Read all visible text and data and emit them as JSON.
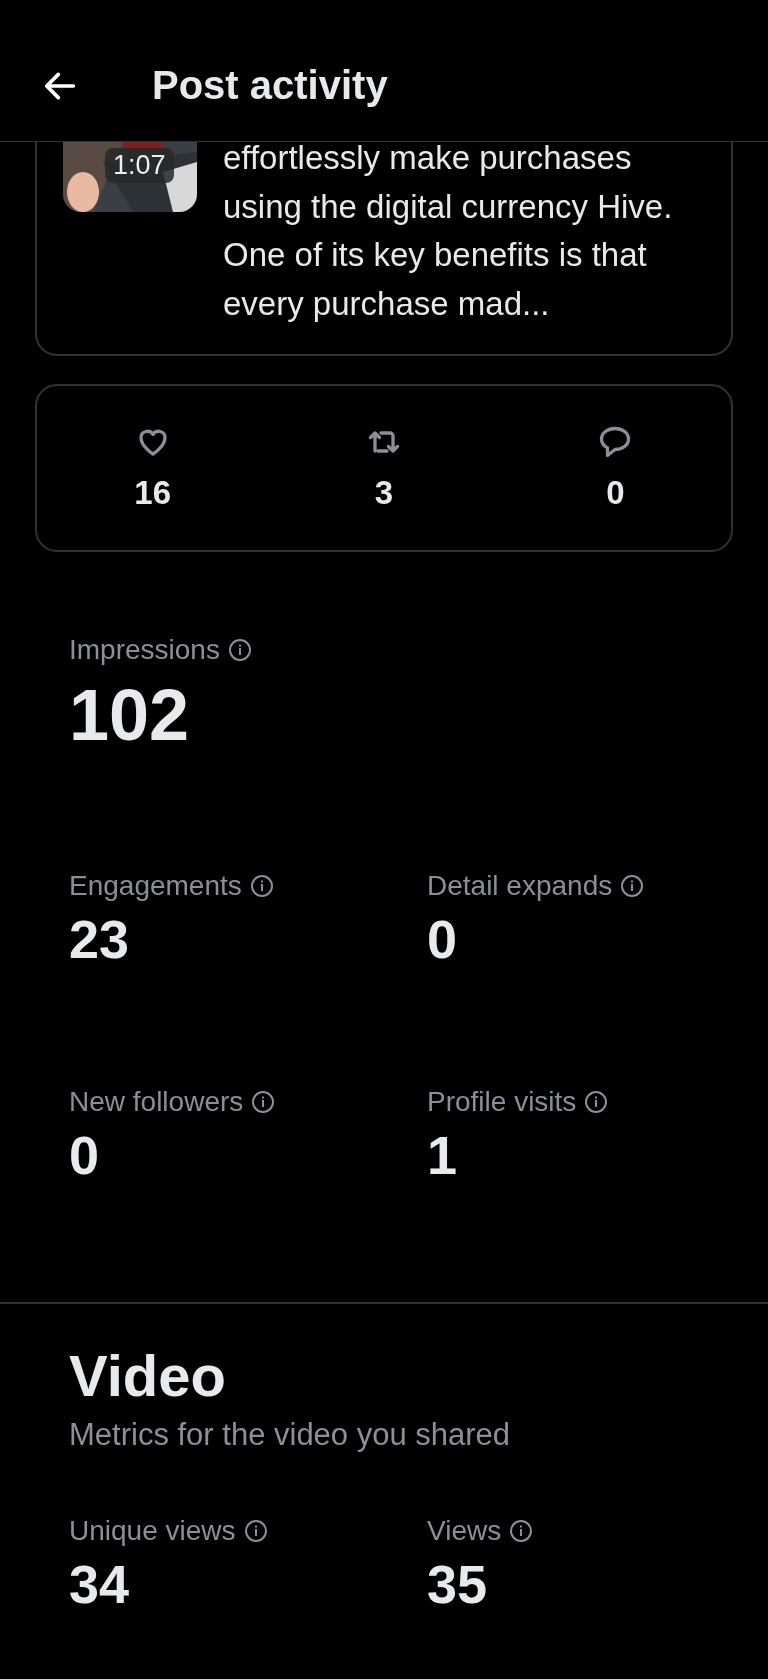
{
  "header": {
    "title": "Post activity"
  },
  "post": {
    "duration": "1:07",
    "excerpt": "effortlessly make purchases using the digital currency Hive. One of its key benefits is that every purchase mad..."
  },
  "actions": [
    {
      "kind": "like",
      "count": "16"
    },
    {
      "kind": "repost",
      "count": "3"
    },
    {
      "kind": "reply",
      "count": "0"
    }
  ],
  "impressions": {
    "label": "Impressions",
    "value": "102"
  },
  "metrics": [
    {
      "label": "Engagements",
      "value": "23"
    },
    {
      "label": "Detail expands",
      "value": "0"
    },
    {
      "label": "New followers",
      "value": "0"
    },
    {
      "label": "Profile visits",
      "value": "1"
    }
  ],
  "video": {
    "title": "Video",
    "subtitle": "Metrics for the video you shared",
    "metrics": [
      {
        "label": "Unique views",
        "value": "34"
      },
      {
        "label": "Views",
        "value": "35"
      }
    ]
  }
}
